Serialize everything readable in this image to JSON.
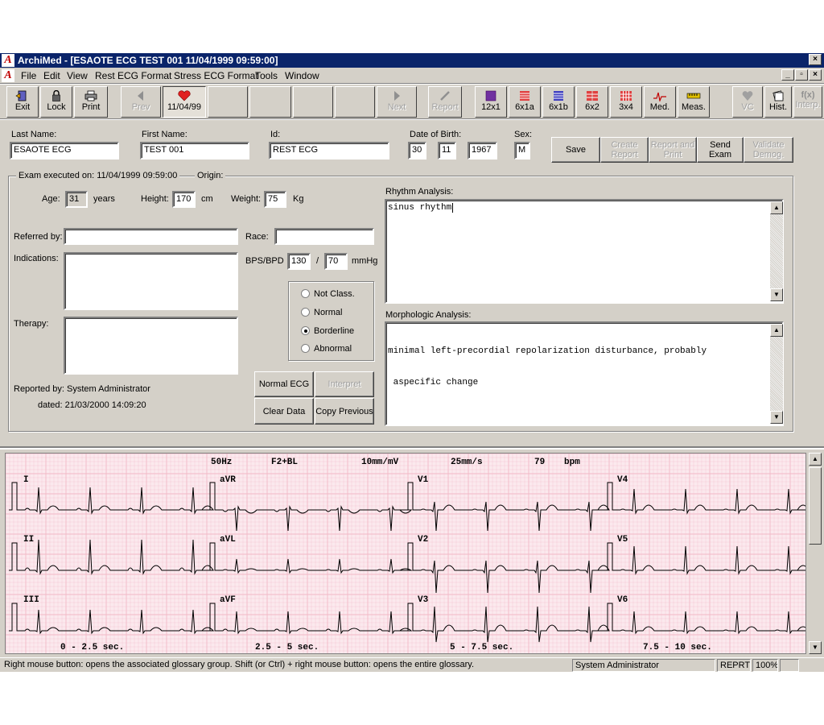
{
  "window": {
    "app_icon": "A",
    "title": "ArchiMed - [ESAOTE ECG TEST 001 11/04/1999 09:59:00]",
    "minimize": "_",
    "restore": "▫",
    "close": "×"
  },
  "menu": [
    "File",
    "Edit",
    "View",
    "Rest ECG Format",
    "Stress ECG Format",
    "Tools",
    "Window"
  ],
  "toolbar": {
    "exit": "Exit",
    "lock": "Lock",
    "print": "Print",
    "prev": "Prev",
    "date_tab": "11/04/99",
    "next": "Next",
    "report": "Report",
    "fmt_12x1": "12x1",
    "fmt_6x1a": "6x1a",
    "fmt_6x1b": "6x1b",
    "fmt_6x2": "6x2",
    "fmt_3x4": "3x4",
    "med": "Med.",
    "meas": "Meas.",
    "vc": "VC",
    "hist": "Hist.",
    "interp": "Interp.",
    "interp_icon": "f(x)"
  },
  "patient": {
    "last_name_label": "Last Name:",
    "last_name": "ESAOTE ECG",
    "first_name_label": "First Name:",
    "first_name": "TEST 001",
    "id_label": "Id:",
    "id": "REST ECG",
    "dob_label": "Date of Birth:",
    "dob_day": "30",
    "dob_month": "11",
    "dob_year": "1967",
    "sex_label": "Sex:",
    "sex": "M"
  },
  "actions": {
    "save": "Save",
    "create_report": "Create Report",
    "report_print": "Report and Print",
    "send_exam": "Send Exam",
    "validate_demog": "Validate Demog."
  },
  "exam": {
    "executed_on": "Exam executed on: 11/04/1999 09:59:00",
    "origin_label": "Origin:",
    "age_label": "Age:",
    "age": "31",
    "age_unit": "years",
    "height_label": "Height:",
    "height": "170",
    "height_unit": "cm",
    "weight_label": "Weight:",
    "weight": "75",
    "weight_unit": "Kg",
    "referred_by_label": "Referred by:",
    "referred_by": "",
    "race_label": "Race:",
    "race": "",
    "indications_label": "Indications:",
    "indications": "",
    "bps_label": "BPS/BPD",
    "bps": "130",
    "bp_sep": "/",
    "bpd": "70",
    "bp_unit": "mmHg",
    "therapy_label": "Therapy:",
    "therapy": "",
    "classification": [
      "Not Class.",
      "Normal",
      "Borderline",
      "Abnormal"
    ],
    "selected_class": "Borderline",
    "reported_by": "Reported by: System Administrator",
    "dated": "dated: 21/03/2000 14:09:20",
    "normal_ecg": "Normal ECG",
    "interpret": "Interpret",
    "clear_data": "Clear Data",
    "copy_previous": "Copy Previous",
    "rhythm_label": "Rhythm Analysis:",
    "rhythm_text": "sinus rhythm",
    "morph_label": "Morphologic Analysis:",
    "morph_text_1": "minimal left-precordial repolarization disturbance, probably",
    "morph_text_2": " aspecific change"
  },
  "ecg": {
    "header": [
      "50Hz",
      "F2+BL",
      "10mm/mV",
      "25mm/s",
      "79",
      "bpm"
    ],
    "leads": [
      [
        "I",
        "aVR",
        "V1",
        "V4"
      ],
      [
        "II",
        "aVL",
        "V2",
        "V5"
      ],
      [
        "III",
        "aVF",
        "V3",
        "V6"
      ]
    ],
    "time_labels": [
      "0 - 2.5 sec.",
      "2.5 - 5 sec.",
      "5 - 7.5 sec.",
      "7.5 - 10 sec."
    ],
    "grid_color": "#f2b8c6",
    "trace_color": "#000000"
  },
  "status": {
    "hint": "Right mouse button: opens the associated glossary group.  Shift (or Ctrl) + right mouse button: opens the entire glossary.",
    "user": "System Administrator",
    "mode": "REPRT",
    "zoom": "100%"
  }
}
